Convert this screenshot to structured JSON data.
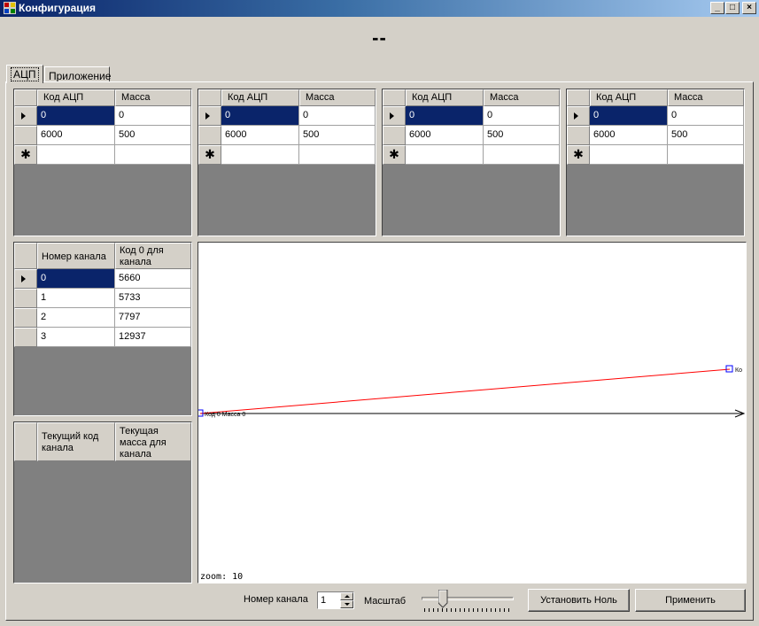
{
  "window": {
    "title": "Конфигурация",
    "minimize": "_",
    "maximize": "□",
    "close": "×"
  },
  "header_value": "--",
  "tabs": [
    {
      "label": "АЦП",
      "active": true
    },
    {
      "label": "Приложение",
      "active": false
    }
  ],
  "calibration_grids": [
    {
      "columns": [
        "Код АЦП",
        "Масса"
      ],
      "rows": [
        [
          "0",
          "0"
        ],
        [
          "6000",
          "500"
        ]
      ]
    },
    {
      "columns": [
        "Код АЦП",
        "Масса"
      ],
      "rows": [
        [
          "0",
          "0"
        ],
        [
          "6000",
          "500"
        ]
      ]
    },
    {
      "columns": [
        "Код АЦП",
        "Масса"
      ],
      "rows": [
        [
          "0",
          "0"
        ],
        [
          "6000",
          "500"
        ]
      ]
    },
    {
      "columns": [
        "Код АЦП",
        "Масса"
      ],
      "rows": [
        [
          "0",
          "0"
        ],
        [
          "6000",
          "500"
        ]
      ]
    }
  ],
  "channel_zero_grid": {
    "columns": [
      "Номер канала",
      "Код 0 для канала"
    ],
    "rows": [
      [
        "0",
        "5660"
      ],
      [
        "1",
        "5733"
      ],
      [
        "2",
        "7797"
      ],
      [
        "3",
        "12937"
      ]
    ]
  },
  "current_grid": {
    "columns": [
      "Текущий код канала",
      "Текущая масса для канала"
    ],
    "rows": []
  },
  "chart": {
    "zoom_label": "zoom: 10",
    "start_point_label": "Код 0 Масса 0",
    "end_point_label": "Ко",
    "line_color": "#ff0000",
    "axis_color": "#000000",
    "marker_color": "#0000ff"
  },
  "controls": {
    "channel_label": "Номер канала",
    "channel_value": "1",
    "scale_label": "Масштаб",
    "scale_fraction": 0.22,
    "set_zero_button": "Установить Ноль",
    "apply_button": "Применить"
  },
  "colors": {
    "selection": "#0a246a",
    "control_face": "#d4d0c8",
    "grid_empty": "#808080"
  }
}
